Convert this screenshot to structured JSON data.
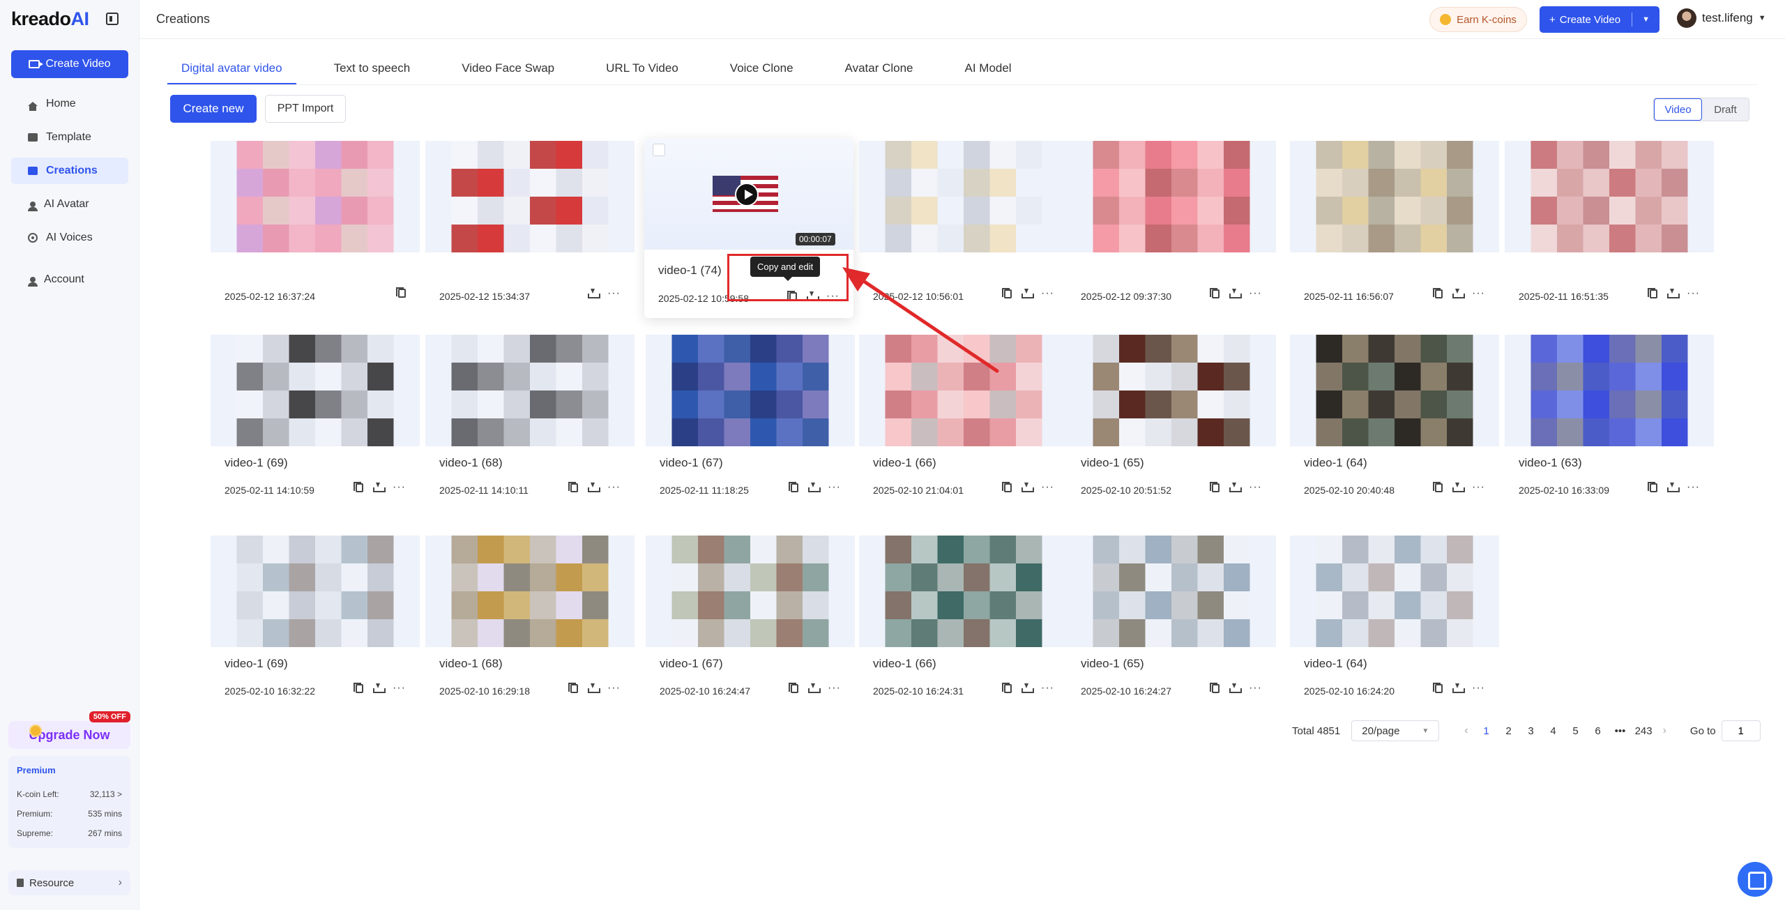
{
  "app": {
    "logo": {
      "main": "kreado",
      "accent": "AI"
    },
    "sidebar": {
      "create_video_label": "Create Video",
      "nav": [
        {
          "label": "Home",
          "icon": "home-icon"
        },
        {
          "label": "Template",
          "icon": "template-icon"
        },
        {
          "label": "Creations",
          "icon": "creations-icon",
          "active": true
        },
        {
          "label": "AI Avatar",
          "icon": "avatar-icon"
        },
        {
          "label": "AI Voices",
          "icon": "voice-icon"
        },
        {
          "label": "Account",
          "icon": "account-icon"
        }
      ],
      "upgrade_label": "Upgrade Now",
      "upgrade_badge": "50% OFF",
      "plan": {
        "title": "Premium",
        "kcoin_label": "K-coin Left:",
        "kcoin_value": "32,113 >",
        "premium_label": "Premium:",
        "premium_value": "535 mins",
        "supreme_label": "Supreme:",
        "supreme_value": "267 mins"
      },
      "resource_label": "Resource"
    },
    "header": {
      "title": "Creations",
      "earn_label": "Earn K-coins",
      "create_video_label": "Create Video",
      "username": "test.lifeng"
    },
    "tabs": [
      "Digital avatar video",
      "Text to speech",
      "Video Face Swap",
      "URL To Video",
      "Voice Clone",
      "Avatar Clone",
      "AI Model"
    ],
    "toolbar": {
      "create_new_label": "Create new",
      "ppt_import_label": "PPT Import",
      "view_video": "Video",
      "view_draft": "Draft"
    },
    "cards": [
      {
        "title": "",
        "date": "2025-02-12 16:37:24",
        "actions": [
          "copy"
        ]
      },
      {
        "title": "",
        "date": "2025-02-12 15:34:37",
        "actions": [
          "download",
          "more"
        ]
      },
      {
        "title": "video-1 (74)",
        "date": "2025-02-12 10:59:58",
        "duration": "00:00:07",
        "featured": true,
        "tooltip": "Copy and edit",
        "actions": [
          "copy",
          "download",
          "more"
        ]
      },
      {
        "title": "",
        "date": "2025-02-12 10:56:01",
        "actions": [
          "copy",
          "download",
          "more"
        ]
      },
      {
        "title": "",
        "date": "2025-02-12 09:37:30",
        "actions": [
          "copy",
          "download",
          "more"
        ]
      },
      {
        "title": "",
        "date": "2025-02-11 16:56:07",
        "actions": [
          "copy",
          "download",
          "more"
        ]
      },
      {
        "title": "",
        "date": "2025-02-11 16:51:35",
        "actions": [
          "copy",
          "download",
          "more"
        ]
      },
      {
        "title": "video-1 (69)",
        "date": "2025-02-11 14:10:59",
        "actions": [
          "copy",
          "download",
          "more"
        ]
      },
      {
        "title": "video-1 (68)",
        "date": "2025-02-11 14:10:11",
        "actions": [
          "copy",
          "download",
          "more"
        ]
      },
      {
        "title": "video-1 (67)",
        "date": "2025-02-11 11:18:25",
        "actions": [
          "copy",
          "download",
          "more"
        ]
      },
      {
        "title": "video-1 (66)",
        "date": "2025-02-10 21:04:01",
        "actions": [
          "copy",
          "download",
          "more"
        ]
      },
      {
        "title": "video-1 (65)",
        "date": "2025-02-10 20:51:52",
        "actions": [
          "copy",
          "download",
          "more"
        ]
      },
      {
        "title": "video-1 (64)",
        "date": "2025-02-10 20:40:48",
        "actions": [
          "copy",
          "download",
          "more"
        ]
      },
      {
        "title": "video-1 (63)",
        "date": "2025-02-10 16:33:09",
        "actions": [
          "copy",
          "download",
          "more"
        ]
      },
      {
        "title": "video-1 (69)",
        "date": "2025-02-10 16:32:22",
        "actions": [
          "copy",
          "download",
          "more"
        ]
      },
      {
        "title": "video-1 (68)",
        "date": "2025-02-10 16:29:18",
        "actions": [
          "copy",
          "download",
          "more"
        ]
      },
      {
        "title": "video-1 (67)",
        "date": "2025-02-10 16:24:47",
        "actions": [
          "copy",
          "download",
          "more"
        ]
      },
      {
        "title": "video-1 (66)",
        "date": "2025-02-10 16:24:31",
        "actions": [
          "copy",
          "download",
          "more"
        ]
      },
      {
        "title": "video-1 (65)",
        "date": "2025-02-10 16:24:27",
        "actions": [
          "copy",
          "download",
          "more"
        ]
      },
      {
        "title": "video-1 (64)",
        "date": "2025-02-10 16:24:20",
        "actions": [
          "copy",
          "download",
          "more"
        ]
      }
    ],
    "pagination": {
      "total": "Total 4851",
      "page_size": "20/page",
      "pages": [
        "1",
        "2",
        "3",
        "4",
        "5",
        "6",
        "•••",
        "243"
      ],
      "current": "1",
      "goto_label": "Go to",
      "goto_value": "1"
    },
    "colors": {
      "accent": "#2f54eb",
      "highlight": "#e0292a"
    }
  }
}
